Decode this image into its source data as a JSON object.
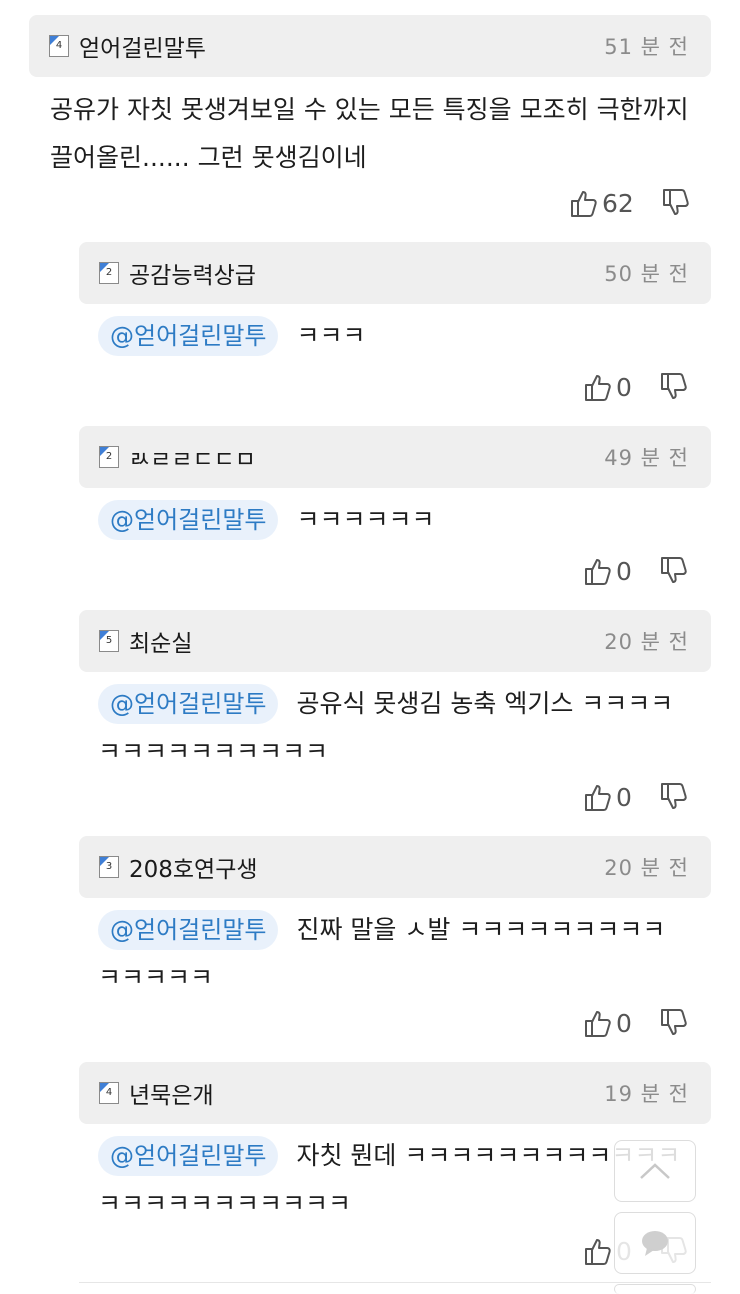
{
  "comments": [
    {
      "level": "4",
      "nickname": "얻어걸린말투",
      "time": "51 분 전",
      "mention": "",
      "text_line1": "공유가 자칫 못생겨보일 수 있는 모든 특징을 모조히 극한까지",
      "text_line2": "끌어올린...... 그런 못생김이네",
      "likes": "62"
    },
    {
      "level": "2",
      "nickname": "공감능력상급",
      "time": "50 분 전",
      "mention": "@얻어걸린말투",
      "text_line1": "ㅋㅋㅋ",
      "text_line2": "",
      "likes": "0"
    },
    {
      "level": "2",
      "nickname": "ㄽㄹㄹㄷㄷㅁ",
      "time": "49 분 전",
      "mention": "@얻어걸린말투",
      "text_line1": "ㅋㅋㅋㅋㅋㅋ",
      "text_line2": "",
      "likes": "0"
    },
    {
      "level": "5",
      "nickname": "최순실",
      "time": "20 분 전",
      "mention": "@얻어걸린말투",
      "text_line1": "공유식 못생김 농축 엑기스 ㅋㅋㅋㅋ",
      "text_line2": "ㅋㅋㅋㅋㅋㅋㅋㅋㅋㅋ",
      "likes": "0"
    },
    {
      "level": "3",
      "nickname": "208호연구생",
      "time": "20 분 전",
      "mention": "@얻어걸린말투",
      "text_line1": "진짜 말을 ㅅ발 ㅋㅋㅋㅋㅋㅋㅋㅋㅋ",
      "text_line2": "ㅋㅋㅋㅋㅋ",
      "likes": "0"
    },
    {
      "level": "4",
      "nickname": "년묵은개",
      "time": "19 분 전",
      "mention": "@얻어걸린말투",
      "text_line1": "자칫 뭔데 ㅋㅋㅋㅋㅋㅋㅋㅋㅋㅋㅋㅋ",
      "text_line2": "ㅋㅋㅋㅋㅋㅋㅋㅋㅋㅋㅋ",
      "likes": "0"
    }
  ],
  "icons": {
    "like": "thumbs-up-icon",
    "dislike": "thumbs-down-icon",
    "scroll_top": "chevron-up-icon",
    "comment": "comment-icon"
  },
  "colors": {
    "header_bg": "#efefef",
    "mention_bg": "#e9f1fb",
    "mention_text": "#2d7bc4",
    "level_badge_accent": "#3f7fd6"
  }
}
